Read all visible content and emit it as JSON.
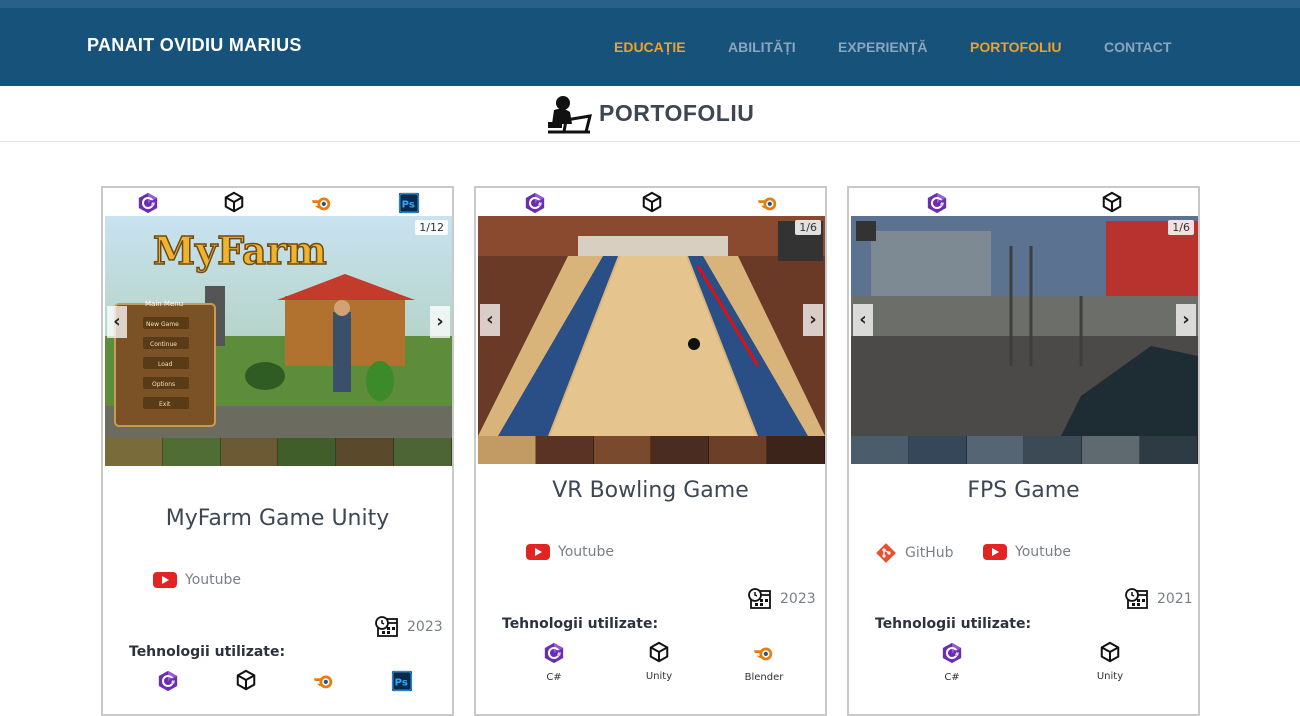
{
  "nav": {
    "brand": "PANAIT OVIDIU MARIUS",
    "items": [
      {
        "label": "EDUCAȚIE",
        "active": true
      },
      {
        "label": "ABILITĂȚI",
        "active": false
      },
      {
        "label": "EXPERIENȚĂ",
        "active": false
      },
      {
        "label": "PORTOFOLIU",
        "active": true
      },
      {
        "label": "CONTACT",
        "active": false
      }
    ]
  },
  "section": {
    "title": "PORTOFOLIU",
    "icon": "person-laptop-icon"
  },
  "colors": {
    "navbar": "#17527a",
    "accent": "#f0a02b",
    "nav_inactive": "#8aa6bd",
    "youtube": "#e32424",
    "github": "#e8502f",
    "csharp": "#6a2fb0"
  },
  "tech_label": "Tehnologii utilizate:",
  "cards": [
    {
      "title": "MyFarm Game Unity",
      "counter": "1/12",
      "top_icons": [
        "csharp-icon",
        "unity-icon",
        "blender-icon",
        "photoshop-icon"
      ],
      "links": [
        {
          "label": "Youtube",
          "icon": "youtube-icon"
        }
      ],
      "year": "2023",
      "bottom_tech": [
        {
          "icon": "csharp-icon",
          "name": ""
        },
        {
          "icon": "unity-icon",
          "name": ""
        },
        {
          "icon": "blender-icon",
          "name": ""
        },
        {
          "icon": "photoshop-icon",
          "name": ""
        }
      ],
      "game_text": {
        "logo": "MyFarm",
        "menu_title": "Main Menu",
        "menu": [
          "New Game",
          "Continue",
          "Load",
          "Options",
          "Exit"
        ]
      }
    },
    {
      "title": "VR Bowling Game",
      "counter": "1/6",
      "top_icons": [
        "csharp-icon",
        "unity-icon",
        "blender-icon"
      ],
      "links": [
        {
          "label": "Youtube",
          "icon": "youtube-icon"
        }
      ],
      "year": "2023",
      "bottom_tech": [
        {
          "icon": "csharp-icon",
          "name": "C#"
        },
        {
          "icon": "unity-icon",
          "name": "Unity"
        },
        {
          "icon": "blender-icon",
          "name": "Blender"
        }
      ]
    },
    {
      "title": "FPS Game",
      "counter": "1/6",
      "top_icons": [
        "csharp-icon",
        "unity-icon"
      ],
      "links": [
        {
          "label": "GitHub",
          "icon": "github-icon"
        },
        {
          "label": "Youtube",
          "icon": "youtube-icon"
        }
      ],
      "year": "2021",
      "bottom_tech": [
        {
          "icon": "csharp-icon",
          "name": "C#"
        },
        {
          "icon": "unity-icon",
          "name": "Unity"
        }
      ]
    }
  ]
}
